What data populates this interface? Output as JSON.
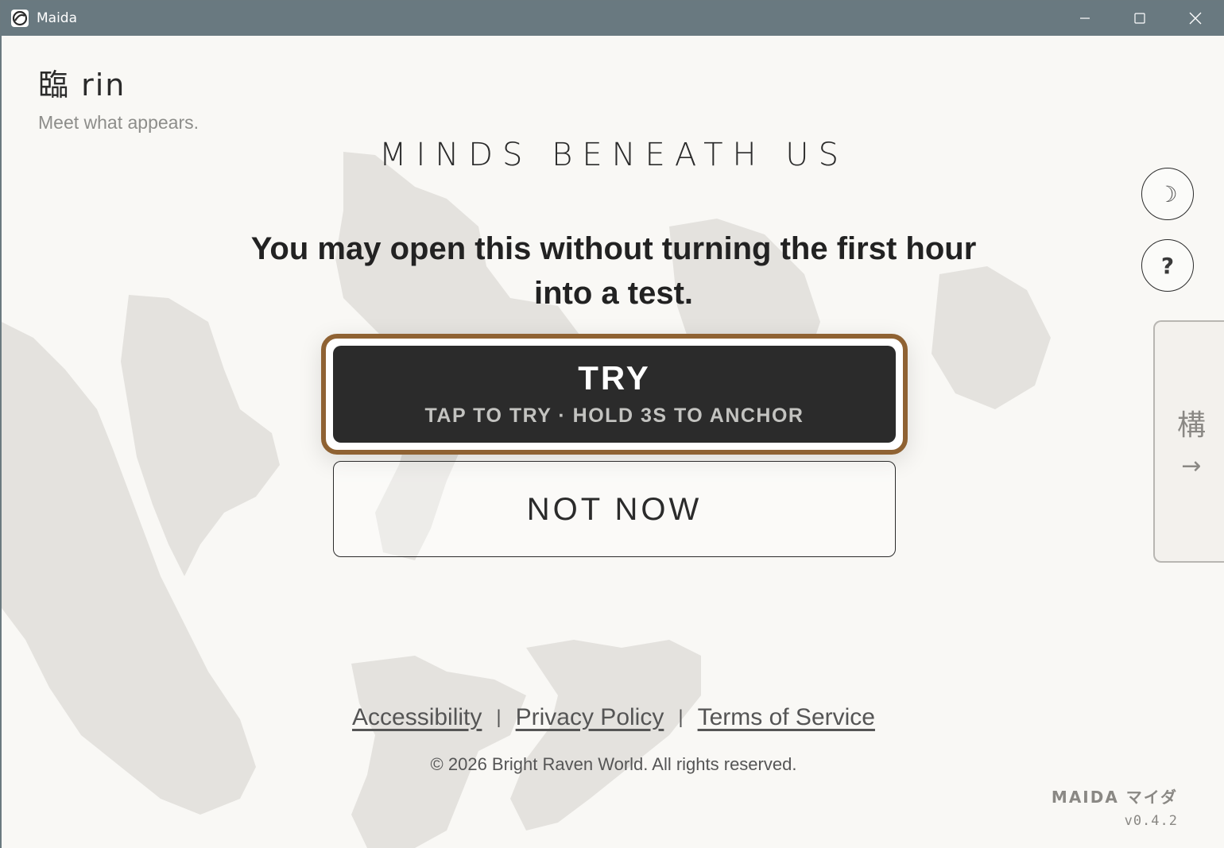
{
  "window": {
    "title": "Maida",
    "icon": "maida-app-icon",
    "controls": {
      "minimize_icon": "minimize-icon",
      "maximize_icon": "maximize-icon",
      "close_icon": "close-icon"
    }
  },
  "header": {
    "kanji_title": "臨 rin",
    "subtitle": "Meet what appears."
  },
  "main": {
    "brand_title": "MINDS BENEATH US",
    "prompt": "You may open this without turning the first hour into a test.",
    "try_button": {
      "label": "TRY",
      "hint": "TAP TO TRY · HOLD 3S TO ANCHOR"
    },
    "not_now_button": {
      "label": "NOT NOW"
    }
  },
  "side": {
    "theme_toggle_icon": "☽",
    "help_icon": "?",
    "tab": {
      "kanji": "構",
      "arrow": "→"
    }
  },
  "footer": {
    "links": [
      "Accessibility",
      "Privacy Policy",
      "Terms of Service"
    ],
    "separator": "|",
    "copyright": "© 2026 Bright Raven World. All rights reserved."
  },
  "brand": {
    "mark": "MAIDA マイダ",
    "version": "v0.4.2"
  },
  "colors": {
    "titlebar": "#697980",
    "background": "#f9f8f5",
    "try_border": "#8f6233",
    "try_fill": "#2b2b2b",
    "text_dark": "#222222",
    "text_muted": "#8d8d8a"
  }
}
